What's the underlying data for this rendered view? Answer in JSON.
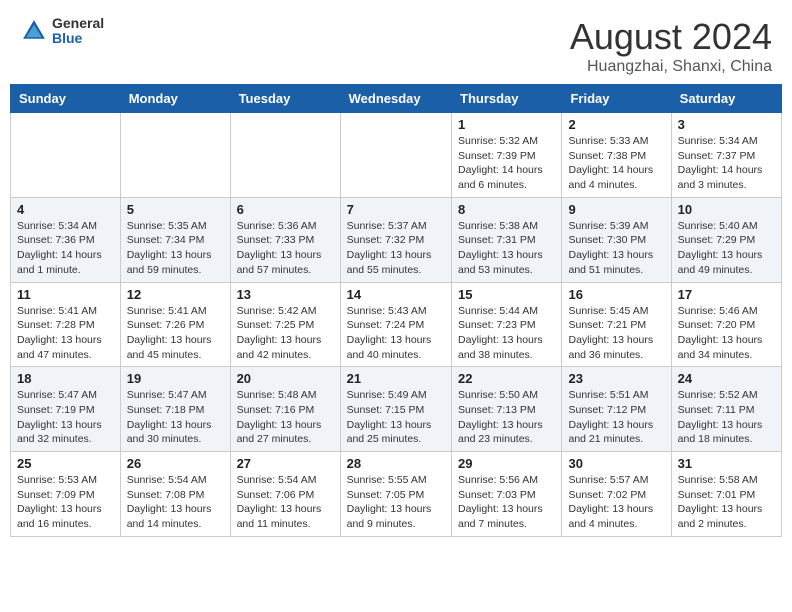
{
  "header": {
    "logo_general": "General",
    "logo_blue": "Blue",
    "month_year": "August 2024",
    "location": "Huangzhai, Shanxi, China"
  },
  "days_of_week": [
    "Sunday",
    "Monday",
    "Tuesday",
    "Wednesday",
    "Thursday",
    "Friday",
    "Saturday"
  ],
  "weeks": [
    [
      {
        "day": "",
        "info": ""
      },
      {
        "day": "",
        "info": ""
      },
      {
        "day": "",
        "info": ""
      },
      {
        "day": "",
        "info": ""
      },
      {
        "day": "1",
        "info": "Sunrise: 5:32 AM\nSunset: 7:39 PM\nDaylight: 14 hours and 6 minutes."
      },
      {
        "day": "2",
        "info": "Sunrise: 5:33 AM\nSunset: 7:38 PM\nDaylight: 14 hours and 4 minutes."
      },
      {
        "day": "3",
        "info": "Sunrise: 5:34 AM\nSunset: 7:37 PM\nDaylight: 14 hours and 3 minutes."
      }
    ],
    [
      {
        "day": "4",
        "info": "Sunrise: 5:34 AM\nSunset: 7:36 PM\nDaylight: 14 hours and 1 minute."
      },
      {
        "day": "5",
        "info": "Sunrise: 5:35 AM\nSunset: 7:34 PM\nDaylight: 13 hours and 59 minutes."
      },
      {
        "day": "6",
        "info": "Sunrise: 5:36 AM\nSunset: 7:33 PM\nDaylight: 13 hours and 57 minutes."
      },
      {
        "day": "7",
        "info": "Sunrise: 5:37 AM\nSunset: 7:32 PM\nDaylight: 13 hours and 55 minutes."
      },
      {
        "day": "8",
        "info": "Sunrise: 5:38 AM\nSunset: 7:31 PM\nDaylight: 13 hours and 53 minutes."
      },
      {
        "day": "9",
        "info": "Sunrise: 5:39 AM\nSunset: 7:30 PM\nDaylight: 13 hours and 51 minutes."
      },
      {
        "day": "10",
        "info": "Sunrise: 5:40 AM\nSunset: 7:29 PM\nDaylight: 13 hours and 49 minutes."
      }
    ],
    [
      {
        "day": "11",
        "info": "Sunrise: 5:41 AM\nSunset: 7:28 PM\nDaylight: 13 hours and 47 minutes."
      },
      {
        "day": "12",
        "info": "Sunrise: 5:41 AM\nSunset: 7:26 PM\nDaylight: 13 hours and 45 minutes."
      },
      {
        "day": "13",
        "info": "Sunrise: 5:42 AM\nSunset: 7:25 PM\nDaylight: 13 hours and 42 minutes."
      },
      {
        "day": "14",
        "info": "Sunrise: 5:43 AM\nSunset: 7:24 PM\nDaylight: 13 hours and 40 minutes."
      },
      {
        "day": "15",
        "info": "Sunrise: 5:44 AM\nSunset: 7:23 PM\nDaylight: 13 hours and 38 minutes."
      },
      {
        "day": "16",
        "info": "Sunrise: 5:45 AM\nSunset: 7:21 PM\nDaylight: 13 hours and 36 minutes."
      },
      {
        "day": "17",
        "info": "Sunrise: 5:46 AM\nSunset: 7:20 PM\nDaylight: 13 hours and 34 minutes."
      }
    ],
    [
      {
        "day": "18",
        "info": "Sunrise: 5:47 AM\nSunset: 7:19 PM\nDaylight: 13 hours and 32 minutes."
      },
      {
        "day": "19",
        "info": "Sunrise: 5:47 AM\nSunset: 7:18 PM\nDaylight: 13 hours and 30 minutes."
      },
      {
        "day": "20",
        "info": "Sunrise: 5:48 AM\nSunset: 7:16 PM\nDaylight: 13 hours and 27 minutes."
      },
      {
        "day": "21",
        "info": "Sunrise: 5:49 AM\nSunset: 7:15 PM\nDaylight: 13 hours and 25 minutes."
      },
      {
        "day": "22",
        "info": "Sunrise: 5:50 AM\nSunset: 7:13 PM\nDaylight: 13 hours and 23 minutes."
      },
      {
        "day": "23",
        "info": "Sunrise: 5:51 AM\nSunset: 7:12 PM\nDaylight: 13 hours and 21 minutes."
      },
      {
        "day": "24",
        "info": "Sunrise: 5:52 AM\nSunset: 7:11 PM\nDaylight: 13 hours and 18 minutes."
      }
    ],
    [
      {
        "day": "25",
        "info": "Sunrise: 5:53 AM\nSunset: 7:09 PM\nDaylight: 13 hours and 16 minutes."
      },
      {
        "day": "26",
        "info": "Sunrise: 5:54 AM\nSunset: 7:08 PM\nDaylight: 13 hours and 14 minutes."
      },
      {
        "day": "27",
        "info": "Sunrise: 5:54 AM\nSunset: 7:06 PM\nDaylight: 13 hours and 11 minutes."
      },
      {
        "day": "28",
        "info": "Sunrise: 5:55 AM\nSunset: 7:05 PM\nDaylight: 13 hours and 9 minutes."
      },
      {
        "day": "29",
        "info": "Sunrise: 5:56 AM\nSunset: 7:03 PM\nDaylight: 13 hours and 7 minutes."
      },
      {
        "day": "30",
        "info": "Sunrise: 5:57 AM\nSunset: 7:02 PM\nDaylight: 13 hours and 4 minutes."
      },
      {
        "day": "31",
        "info": "Sunrise: 5:58 AM\nSunset: 7:01 PM\nDaylight: 13 hours and 2 minutes."
      }
    ]
  ]
}
